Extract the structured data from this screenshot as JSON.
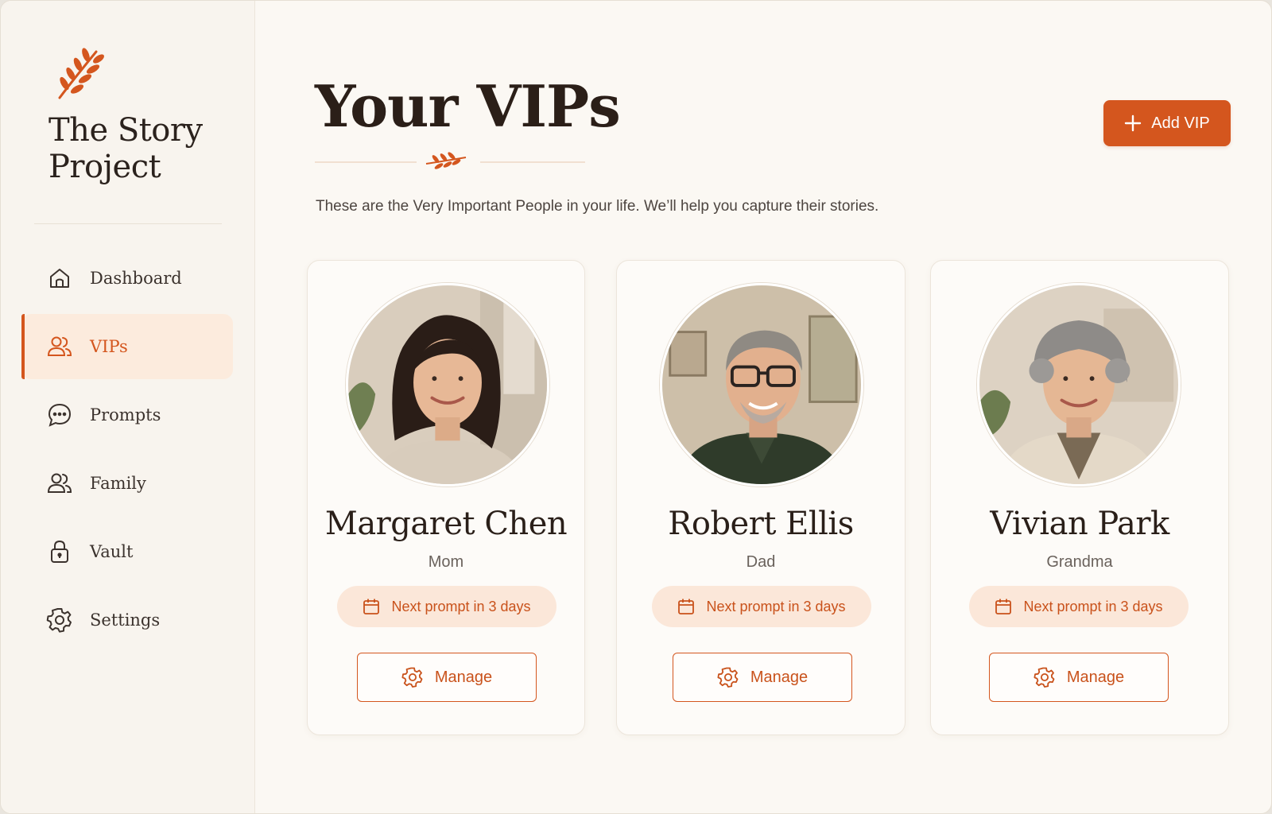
{
  "brand": {
    "line1": "The Story",
    "line2": "Project"
  },
  "nav": [
    {
      "label": "Dashboard",
      "icon": "home-icon"
    },
    {
      "label": "VIPs",
      "icon": "users-icon",
      "active": true
    },
    {
      "label": "Prompts",
      "icon": "chat-bubble-icon"
    },
    {
      "label": "Family",
      "icon": "family-icon"
    },
    {
      "label": "Vault",
      "icon": "lock-icon"
    },
    {
      "label": "Settings",
      "icon": "gear-icon"
    }
  ],
  "header": {
    "title": "Your VIPs",
    "subtitle": "These are the Very Important People in your life. We’ll help you capture their stories.",
    "add_button": "Add VIP"
  },
  "vips": [
    {
      "name": "Margaret Chen",
      "relation": "Mom",
      "prompt": "Next prompt in 3 days",
      "manage": "Manage"
    },
    {
      "name": "Robert Ellis",
      "relation": "Dad",
      "prompt": "Next prompt in 3 days",
      "manage": "Manage"
    },
    {
      "name": "Vivian Park",
      "relation": "Grandma",
      "prompt": "Next prompt in 3 days",
      "manage": "Manage"
    }
  ],
  "colors": {
    "accent": "#d4561e",
    "accent_soft": "#fbe7d9",
    "background": "#fbf8f3"
  }
}
